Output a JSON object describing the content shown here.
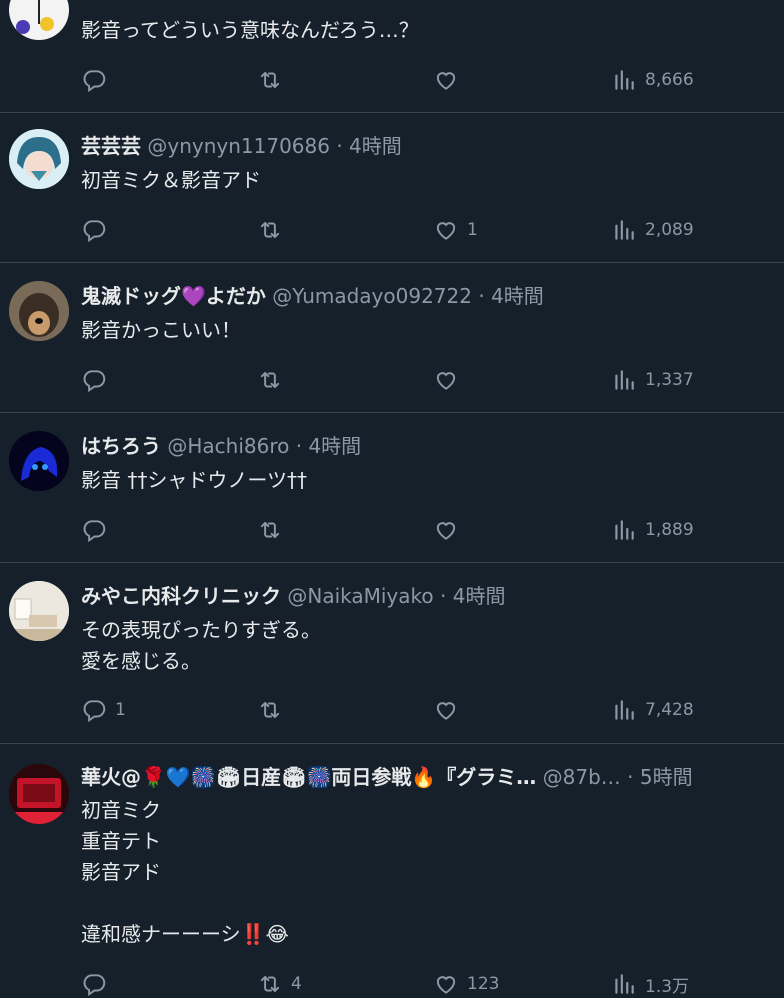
{
  "tweets": [
    {
      "name": "",
      "handle": "",
      "time": "",
      "lines": [
        "影音ってどういう意味なんだろう…？"
      ],
      "replies": "",
      "retweets": "",
      "likes": "",
      "views": "8,666"
    },
    {
      "name": "芸芸芸",
      "handle": "@ynynyn1170686",
      "time": "4時間",
      "lines": [
        "初音ミク＆影音アド"
      ],
      "replies": "",
      "retweets": "",
      "likes": "1",
      "views": "2,089"
    },
    {
      "name": "鬼滅ドッグ💜よだか",
      "handle": "@Yumadayo092722",
      "time": "4時間",
      "lines": [
        "影音かっこいい！"
      ],
      "replies": "",
      "retweets": "",
      "likes": "",
      "views": "1,337"
    },
    {
      "name": "はちろう",
      "handle": "@Hachi86ro",
      "time": "4時間",
      "lines": [
        "影音 ††シャドウノーツ††"
      ],
      "replies": "",
      "retweets": "",
      "likes": "",
      "views": "1,889"
    },
    {
      "name": "みやこ内科クリニック",
      "handle": "@NaikaMiyako",
      "time": "4時間",
      "lines": [
        "その表現ぴったりすぎる。",
        "愛を感じる。"
      ],
      "replies": "1",
      "retweets": "",
      "likes": "",
      "views": "7,428"
    },
    {
      "name": "華火@🌹💙🎆🏟日産🏟🎆両日参戦🔥『グラミ…",
      "handle": "@87b…",
      "time": "5時間",
      "lines": [
        "初音ミク",
        "重音テト",
        "影音アド",
        "",
        "違和感ナーーーシ‼️😂"
      ],
      "replies": "",
      "retweets": "4",
      "likes": "123",
      "views": "1.3万"
    }
  ],
  "sep": "·",
  "icons": [
    "reply-icon",
    "retweet-icon",
    "like-icon",
    "views-icon"
  ],
  "colors": {
    "background": "#15202b",
    "text": "#e7e9ea",
    "muted": "#8b98a5",
    "divider": "#38444d"
  }
}
